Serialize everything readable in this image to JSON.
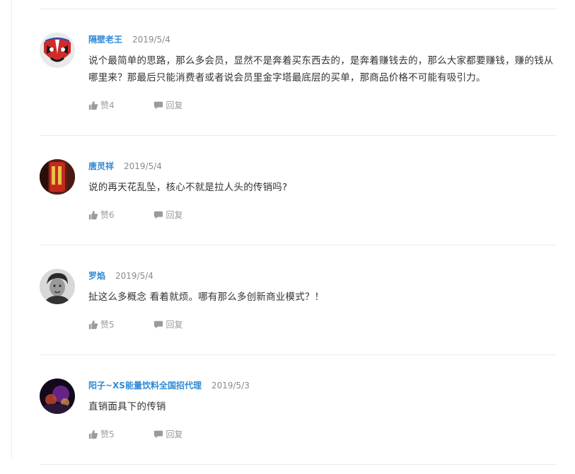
{
  "comments": [
    {
      "author": "隔壁老王",
      "date": "2019/5/4",
      "content": "说个最简单的思路，那么多会员，显然不是奔着买东西去的，是奔着赚钱去的，那么大家都要赚钱，赚的钱从哪里来？那最后只能消费者或者说会员里金字塔最底层的买单，那商品价格不可能有吸引力。",
      "like_label": "赞4",
      "reply_label": "回复"
    },
    {
      "author": "唐灵祥",
      "date": "2019/5/4",
      "content": "说的再天花乱坠，核心不就是拉人头的传销吗?",
      "like_label": "赞6",
      "reply_label": "回复"
    },
    {
      "author": "罗焰",
      "date": "2019/5/4",
      "content": "扯这么多概念 看着就烦。哪有那么多创新商业模式？！",
      "like_label": "赞5",
      "reply_label": "回复"
    },
    {
      "author": "阳子~XS能量饮料全国招代理",
      "date": "2019/5/3",
      "content": "直销面具下的传销",
      "like_label": "赞5",
      "reply_label": "回复"
    }
  ],
  "colors": {
    "author": "#2f8ad4",
    "meta": "#8a8a8a",
    "action": "#9b9b9b",
    "divider": "#ececec"
  },
  "icons": {
    "like": "thumbs-up-icon",
    "reply": "speech-bubble-icon"
  }
}
